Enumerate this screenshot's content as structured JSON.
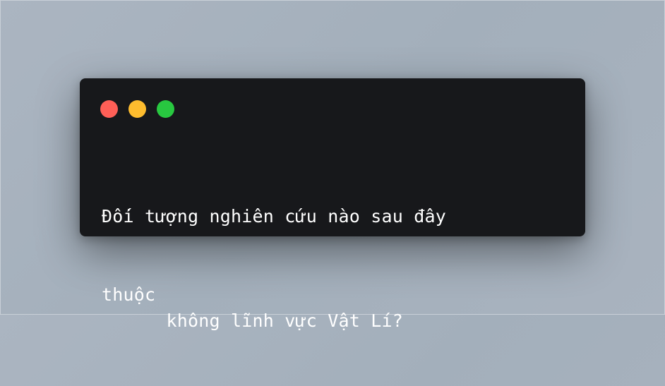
{
  "window": {
    "controls": {
      "close": {
        "icon": "close-dot-icon",
        "color": "#ff5f57"
      },
      "minimize": {
        "icon": "minimize-dot-icon",
        "color": "#febc2e"
      },
      "maximize": {
        "icon": "maximize-dot-icon",
        "color": "#28c840"
      }
    },
    "background_color": "#17181b"
  },
  "code": {
    "line1": "Đối tượng nghiên cứu nào sau đây",
    "line2": "không lĩnh vực Vật Lí?",
    "line2_overlap": "thuộc"
  }
}
